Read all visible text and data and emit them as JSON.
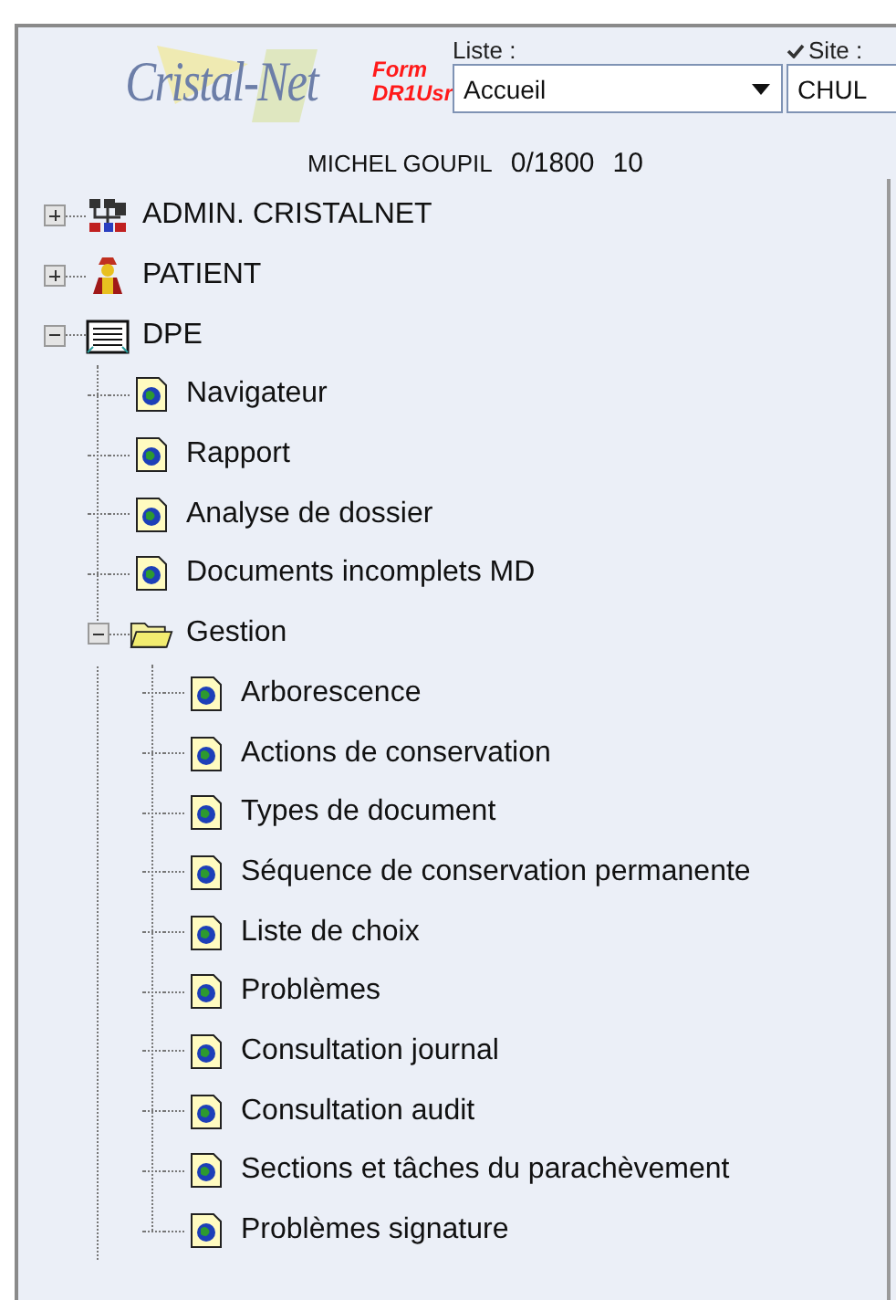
{
  "header": {
    "logo": "Cristal-Net",
    "form_label": [
      "Form",
      "DR1Usr"
    ],
    "list": {
      "label": "Liste :",
      "value": "Accueil"
    },
    "site": {
      "label": "Site :",
      "checked": true,
      "value": "CHUL"
    }
  },
  "user": {
    "name": "MICHEL GOUPIL",
    "counter": "0/1800",
    "number": "10"
  },
  "tree": [
    {
      "label": "ADMIN. CRISTALNET",
      "kind": "admin",
      "expanded": false
    },
    {
      "label": "PATIENT",
      "kind": "patient",
      "expanded": false
    },
    {
      "label": "DPE",
      "kind": "binder",
      "expanded": true,
      "children": [
        {
          "label": "Navigateur",
          "kind": "document"
        },
        {
          "label": "Rapport",
          "kind": "document"
        },
        {
          "label": "Analyse de dossier",
          "kind": "document"
        },
        {
          "label": "Documents incomplets MD",
          "kind": "document"
        },
        {
          "label": "Gestion",
          "kind": "folder",
          "expanded": true,
          "children": [
            {
              "label": "Arborescence",
              "kind": "document"
            },
            {
              "label": "Actions de conservation",
              "kind": "document"
            },
            {
              "label": "Types de document",
              "kind": "document"
            },
            {
              "label": "Séquence de conservation permanente",
              "kind": "document"
            },
            {
              "label": "Liste de choix",
              "kind": "document"
            },
            {
              "label": "Problèmes",
              "kind": "document"
            },
            {
              "label": "Consultation journal",
              "kind": "document"
            },
            {
              "label": "Consultation audit",
              "kind": "document"
            },
            {
              "label": "Sections et tâches du parachèvement",
              "kind": "document"
            },
            {
              "label": "Problèmes signature",
              "kind": "document"
            }
          ]
        }
      ]
    }
  ]
}
